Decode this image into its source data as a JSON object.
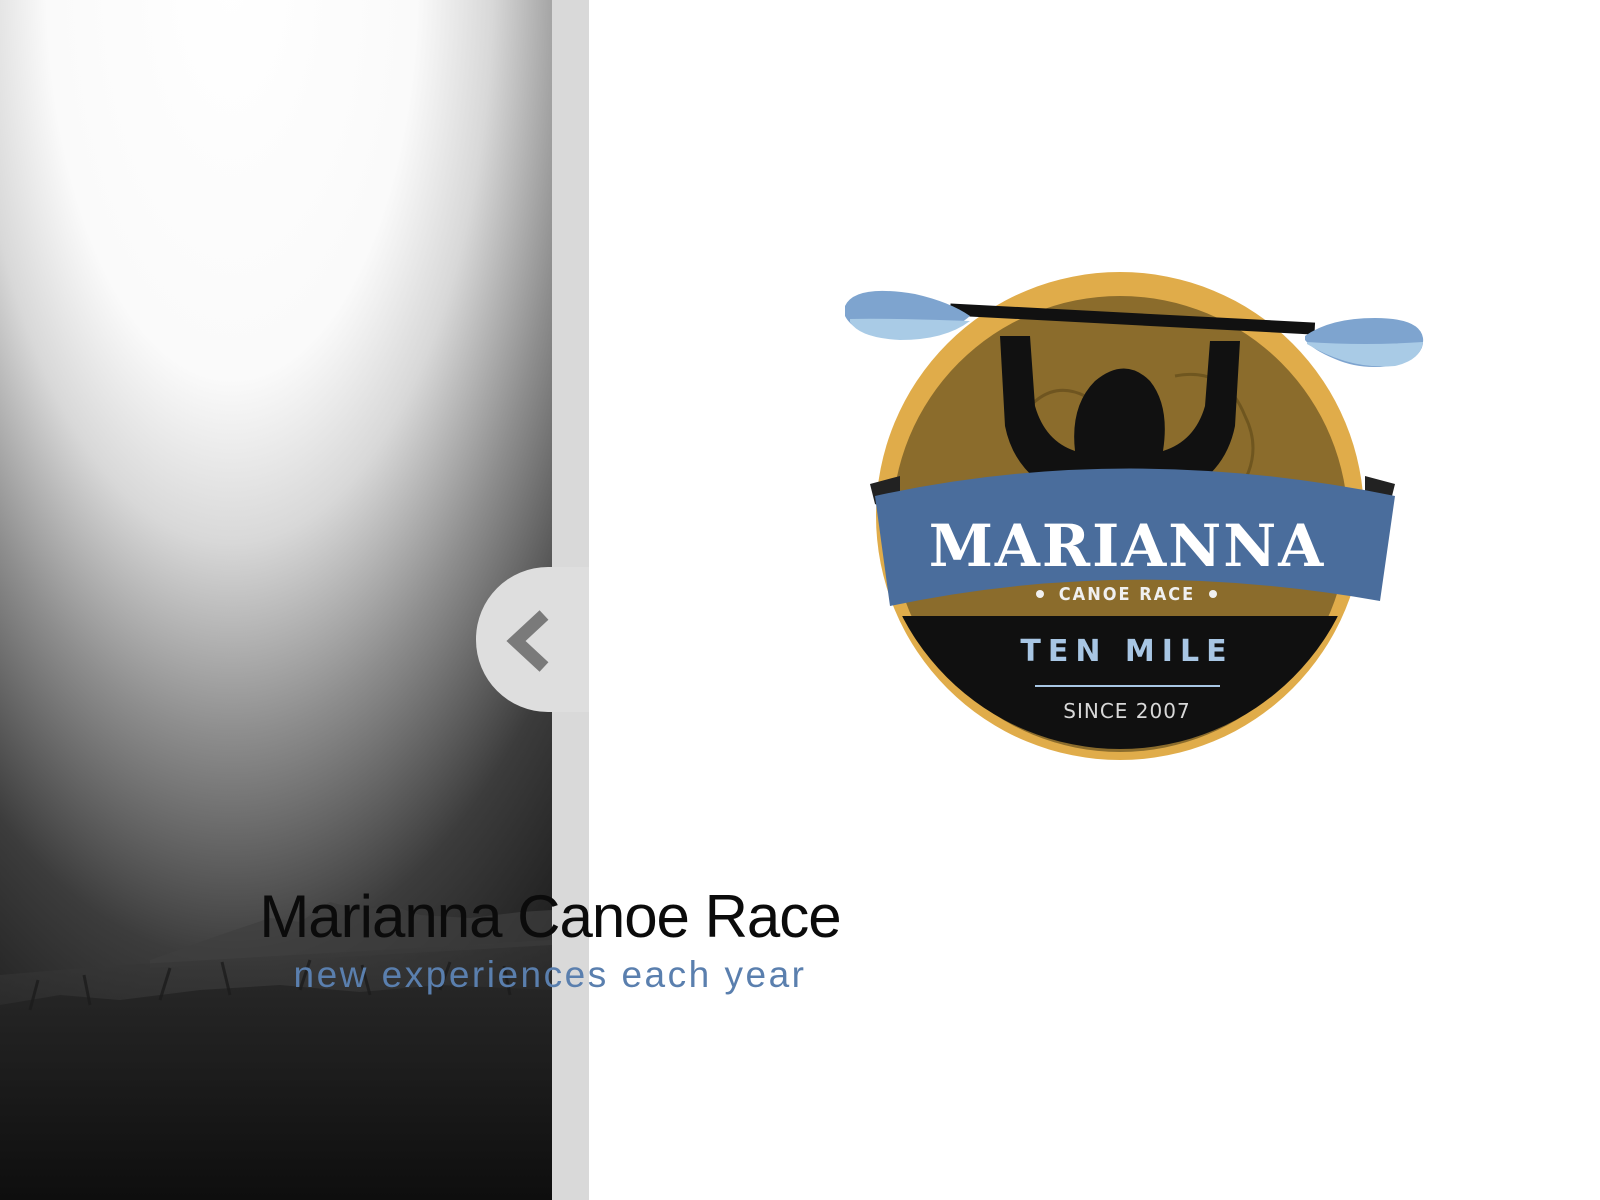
{
  "hero": {
    "image": "misty-river-landscape-photo"
  },
  "nav": {
    "collapse_icon": "chevron-left-icon"
  },
  "logo": {
    "alt": "Marianna Canoe Race Ten Mile Since 2007 logo",
    "banner_text": "MARIANNA",
    "sub_text": "CANOE RACE",
    "lower_text": "TEN MILE",
    "since_text": "SINCE 2007",
    "colors": {
      "gold": "#e0ac4a",
      "bronze": "#8b6c2c",
      "banner_blue": "#4a6d9c",
      "paddle_blue": "#7ea4cf",
      "paddle_light": "#a9cbe6",
      "dark": "#111111",
      "ten_mile": "#a8c6e4"
    }
  },
  "site": {
    "title": "Marianna Canoe Race",
    "tagline": "new experiences each year",
    "tagline_color": "#5a7fae"
  }
}
